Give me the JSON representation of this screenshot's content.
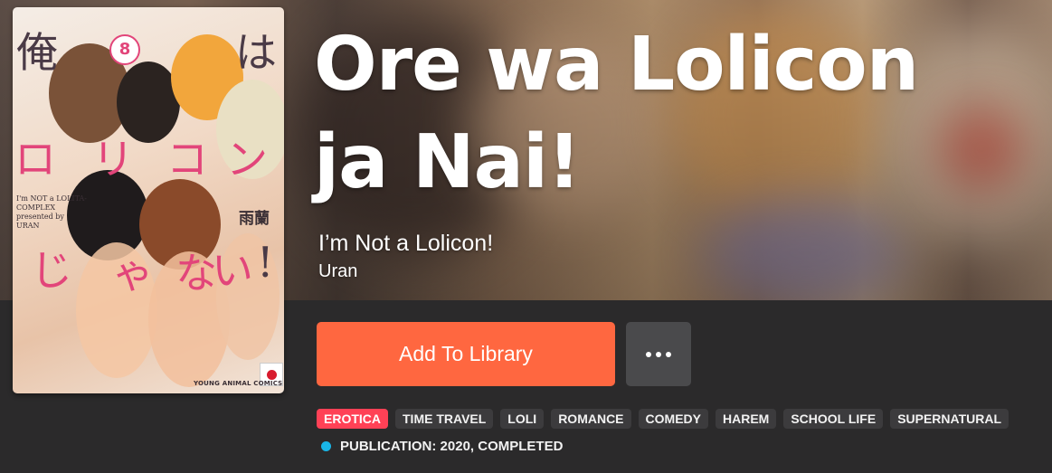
{
  "manga": {
    "title_line1": "Ore wa Lolicon",
    "title_line2": "ja Nai!",
    "alt_title": "I’m Not a Lolicon!",
    "author": "Uran"
  },
  "cover": {
    "jp_chars": [
      "俺",
      "は",
      "ロ",
      "リ",
      "コ",
      "ン",
      "じ",
      "ゃ",
      "な",
      "い",
      "!"
    ],
    "volume": "8",
    "subtitle_en": "I'm NOT a LOLITA-COMPLEX presented by URAN",
    "author_jp": "雨蘭",
    "publisher": "YOUNG ANIMAL COMICS",
    "flag": "japan-flag"
  },
  "actions": {
    "add_label": "Add To Library",
    "more_icon": "ellipsis-icon"
  },
  "tags": [
    {
      "label": "EROTICA",
      "highlight": true
    },
    {
      "label": "TIME TRAVEL",
      "highlight": false
    },
    {
      "label": "LOLI",
      "highlight": false
    },
    {
      "label": "ROMANCE",
      "highlight": false
    },
    {
      "label": "COMEDY",
      "highlight": false
    },
    {
      "label": "HAREM",
      "highlight": false
    },
    {
      "label": "SCHOOL LIFE",
      "highlight": false
    },
    {
      "label": "SUPERNATURAL",
      "highlight": false
    }
  ],
  "publication": {
    "text": "PUBLICATION: 2020, COMPLETED",
    "status_color": "#19b6e8"
  },
  "colors": {
    "accent": "#ff6740",
    "tag_highlight": "#ff4156",
    "background": "#2b2a2b"
  }
}
